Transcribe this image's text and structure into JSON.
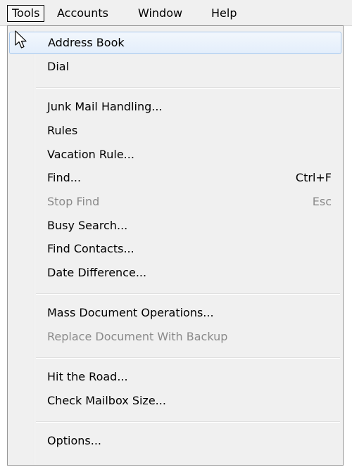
{
  "menubar": {
    "items": [
      {
        "label": "Tools"
      },
      {
        "label": "Accounts"
      },
      {
        "label": "Window"
      },
      {
        "label": "Help"
      }
    ]
  },
  "tools_menu": {
    "items": [
      {
        "label": "Address Book",
        "state": "highlighted"
      },
      {
        "label": "Dial"
      },
      {
        "label": "Junk Mail Handling..."
      },
      {
        "label": "Rules"
      },
      {
        "label": "Vacation Rule..."
      },
      {
        "label": "Find...",
        "shortcut": "Ctrl+F"
      },
      {
        "label": "Stop Find",
        "shortcut": "Esc",
        "state": "disabled"
      },
      {
        "label": "Busy Search..."
      },
      {
        "label": "Find Contacts..."
      },
      {
        "label": "Date Difference..."
      },
      {
        "label": "Mass Document Operations..."
      },
      {
        "label": "Replace Document With Backup",
        "state": "disabled"
      },
      {
        "label": "Hit the Road..."
      },
      {
        "label": "Check Mailbox Size..."
      },
      {
        "label": "Options..."
      }
    ]
  },
  "icons": {
    "pointer": "mouse-pointer-icon"
  }
}
